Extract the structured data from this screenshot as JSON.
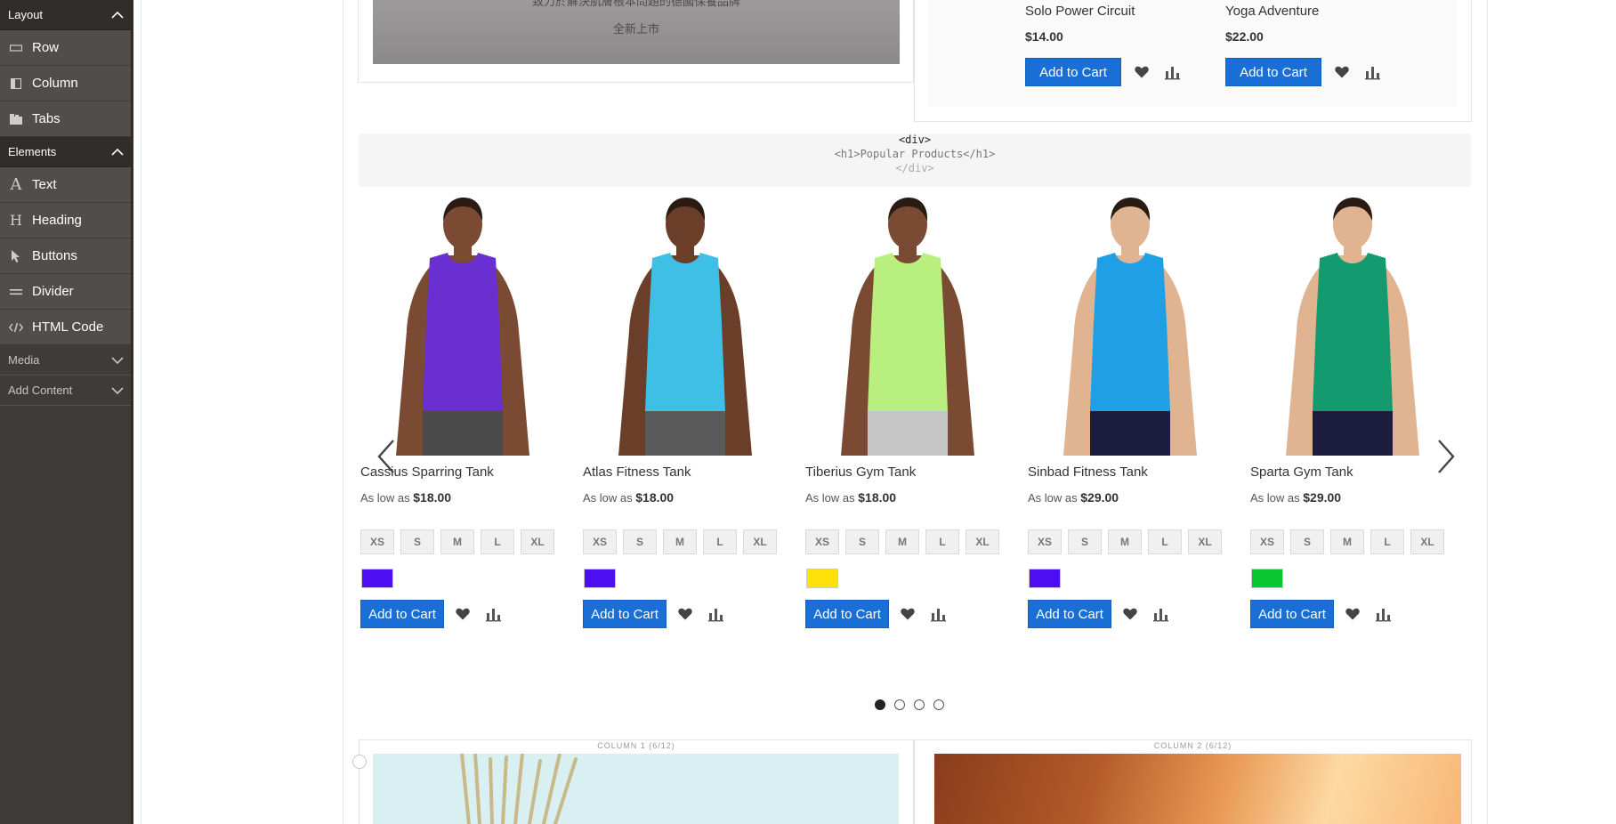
{
  "sidebar": {
    "sections": {
      "layout": {
        "label": "Layout",
        "items": [
          {
            "label": "Row"
          },
          {
            "label": "Column"
          },
          {
            "label": "Tabs"
          }
        ]
      },
      "elements": {
        "label": "Elements",
        "items": [
          {
            "label": "Text"
          },
          {
            "label": "Heading"
          },
          {
            "label": "Buttons"
          },
          {
            "label": "Divider"
          },
          {
            "label": "HTML Code"
          }
        ]
      },
      "media": {
        "label": "Media"
      },
      "add_content": {
        "label": "Add Content"
      }
    }
  },
  "promo": {
    "line1": "致力於解決肌膚根本問題的德國保養品牌",
    "line2": "全新上市"
  },
  "top_products": [
    {
      "name": "Solo Power Circuit",
      "price": "$14.00",
      "cart_label": "Add to Cart"
    },
    {
      "name": "Yoga Adventure",
      "price": "$22.00",
      "cart_label": "Add to Cart"
    }
  ],
  "html_code_block": {
    "line1": "<div>",
    "line2": "<h1>Popular Products</h1>",
    "line3": "</div>"
  },
  "carousel": {
    "products": [
      {
        "name": "Cassius Sparring Tank",
        "price_prefix": "As low as",
        "price": "$18.00",
        "sizes": [
          "XS",
          "S",
          "M",
          "L",
          "XL"
        ],
        "swatch_color": "#4d0ef2",
        "tank_color": "#6a2fd1",
        "shorts_color": "#4a4a4a",
        "skin_color": "#7a4a32",
        "cart_label": "Add to Cart"
      },
      {
        "name": "Atlas Fitness Tank",
        "price_prefix": "As low as",
        "price": "$18.00",
        "sizes": [
          "XS",
          "S",
          "M",
          "L",
          "XL"
        ],
        "swatch_color": "#4d0ef2",
        "tank_color": "#3ec0e6",
        "shorts_color": "#5a5a5a",
        "skin_color": "#6b3e2a",
        "cart_label": "Add to Cart"
      },
      {
        "name": "Tiberius Gym Tank",
        "price_prefix": "As low as",
        "price": "$18.00",
        "sizes": [
          "XS",
          "S",
          "M",
          "L",
          "XL"
        ],
        "swatch_color": "#ffe10a",
        "tank_color": "#b8ef7e",
        "shorts_color": "#c6c6c6",
        "skin_color": "#7a4a32",
        "cart_label": "Add to Cart"
      },
      {
        "name": "Sinbad Fitness Tank",
        "price_prefix": "As low as",
        "price": "$29.00",
        "sizes": [
          "XS",
          "S",
          "M",
          "L",
          "XL"
        ],
        "swatch_color": "#4d0ef2",
        "tank_color": "#1e9fe6",
        "shorts_color": "#1c1c3c",
        "skin_color": "#e0b391",
        "cart_label": "Add to Cart"
      },
      {
        "name": "Sparta Gym Tank",
        "price_prefix": "As low as",
        "price": "$29.00",
        "sizes": [
          "XS",
          "S",
          "M",
          "L",
          "XL"
        ],
        "swatch_color": "#0ac631",
        "tank_color": "#139a6e",
        "shorts_color": "#1c1c3c",
        "skin_color": "#e0b391",
        "cart_label": "Add to Cart"
      }
    ],
    "pages": 4,
    "active_page": 1
  },
  "columns": {
    "col1_label": "COLUMN 1 (6/12)",
    "col2_label": "COLUMN 2 (6/12)"
  },
  "colors": {
    "sidebar_bg": "#3e3b38",
    "cart_button": "#1a6fd6"
  }
}
